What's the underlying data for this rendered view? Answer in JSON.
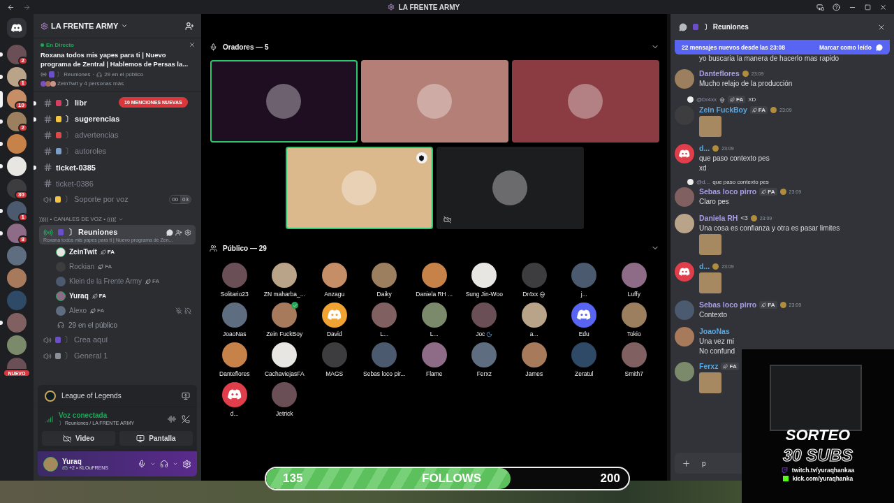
{
  "titlebar": {
    "title": "LA FRENTE ARMY"
  },
  "servers": [
    {
      "kind": "count",
      "badge": "2",
      "unread": true,
      "selected": false
    },
    {
      "kind": "count",
      "badge": "1",
      "unread": true,
      "selected": false
    },
    {
      "kind": "count",
      "badge": "10",
      "unread": false,
      "selected": true
    },
    {
      "kind": "count",
      "badge": "2",
      "unread": true,
      "selected": false
    },
    {
      "kind": "plain",
      "unread": true,
      "selected": false
    },
    {
      "kind": "plain",
      "unread": true,
      "selected": false
    },
    {
      "kind": "count",
      "badge": "30",
      "unread": false,
      "selected": false
    },
    {
      "kind": "count",
      "badge": "1",
      "unread": true,
      "selected": false
    },
    {
      "kind": "count",
      "badge": "8",
      "unread": true,
      "selected": false
    },
    {
      "kind": "plain",
      "unread": false,
      "selected": false
    },
    {
      "kind": "plain",
      "unread": false,
      "selected": false
    },
    {
      "kind": "plain",
      "unread": false,
      "selected": false
    },
    {
      "kind": "plain",
      "unread": true,
      "selected": false
    },
    {
      "kind": "plain",
      "unread": false,
      "selected": false
    },
    {
      "kind": "new",
      "badge": "NUEVO",
      "unread": false,
      "selected": false
    }
  ],
  "server_header": {
    "name": "LA FRENTE ARMY"
  },
  "live_card": {
    "status": "En Directo",
    "title": "Roxana todos mis yapes para ti | Nuevo programa de Zentral | Hablemos de Persas la...",
    "channel": "〕 Reuniones",
    "separator": "·",
    "audience": "29 en el público",
    "people": "ZeinTwit y 4 personas más"
  },
  "channels": [
    {
      "kind": "text",
      "name": "〕 libr",
      "unread": true,
      "mention": "10 MENCIONES NUEVAS"
    },
    {
      "kind": "text",
      "name": "〕 sugerencias",
      "unread": true
    },
    {
      "kind": "text",
      "name": "〕 advertencias",
      "unread": false
    },
    {
      "kind": "text",
      "name": "〕 autoroles",
      "unread": false
    },
    {
      "kind": "thread",
      "name": "ticket-0385",
      "unread": true
    },
    {
      "kind": "thread",
      "name": "ticket-0386",
      "unread": false
    },
    {
      "kind": "voice",
      "name": "〕 Soporte por voz",
      "unread": false,
      "counter": [
        "00",
        "03"
      ]
    }
  ],
  "voice_category": "))))) • CANALES DE VOZ • (((((",
  "stage_channel": {
    "name": "〕 Reuniones",
    "subtitle": "Roxana todos mis yapes para ti | Nuevo programa de Zen...",
    "selected": true
  },
  "participants": [
    {
      "name": "ZeinTwit",
      "tag": "FA",
      "active": true,
      "muted": false
    },
    {
      "name": "Rockian",
      "tag": "FA",
      "active": false,
      "muted": false
    },
    {
      "name": "Klein de la Frente Army",
      "tag": "FA",
      "active": false,
      "muted": false
    },
    {
      "name": "Yuraq",
      "tag": "FA",
      "active": true,
      "muted": false
    },
    {
      "name": "Alexo",
      "tag": "FA",
      "active": false,
      "muted": true
    }
  ],
  "audience_count": "29 en el público",
  "more_voice_channels": [
    {
      "name": "〕 Crea aquí"
    },
    {
      "name": "〕 General 1"
    }
  ],
  "activity": {
    "game": "League of Legends"
  },
  "voice": {
    "status": "Voz conectada",
    "location": "〕 Reuniones / LA FRENTE ARMY"
  },
  "media_buttons": [
    {
      "kind": "video",
      "label": "Video"
    },
    {
      "kind": "screen",
      "label": "Pantalla"
    }
  ],
  "user": {
    "name": "Yuraq",
    "extra": "+2 •",
    "custom": "KLOuFRENS"
  },
  "stage": {
    "speakers_header": "Oradores — 5",
    "audience_header": "Público — 29"
  },
  "speakers": [
    {
      "color": "#1f0d22",
      "speaking": true,
      "moderator": false,
      "muted": false
    },
    {
      "color": "#b47f76",
      "speaking": false,
      "moderator": false,
      "muted": false
    },
    {
      "color": "#8a3c42",
      "speaking": false,
      "moderator": false,
      "muted": false
    },
    {
      "color": "#dcb98c",
      "speaking": true,
      "moderator": true,
      "muted": false
    },
    {
      "color": "#1c1d1f",
      "speaking": false,
      "moderator": false,
      "muted": true
    }
  ],
  "audience": [
    {
      "name": "Solitario23",
      "kind": "photo"
    },
    {
      "name": "ZN maharba_...",
      "kind": "photo"
    },
    {
      "name": "Anzagu",
      "kind": "photo"
    },
    {
      "name": "Daiky",
      "kind": "photo"
    },
    {
      "name": "Daniela RH ...",
      "kind": "photo"
    },
    {
      "name": "Sung Jin-Woo",
      "kind": "photo"
    },
    {
      "name": "Dr4xx",
      "kind": "photo",
      "skull": true
    },
    {
      "name": "j...",
      "kind": "photo"
    },
    {
      "name": "Luffy",
      "kind": "photo"
    },
    {
      "name": "JoaoNas",
      "kind": "photo"
    },
    {
      "name": "Zein FuckBoy",
      "kind": "photo",
      "verified": true
    },
    {
      "name": "David",
      "kind": "discord",
      "color": "#f0a232"
    },
    {
      "name": "L...",
      "kind": "photo"
    },
    {
      "name": "L...",
      "kind": "photo"
    },
    {
      "name": "Joc",
      "kind": "photo",
      "sleep": true
    },
    {
      "name": "a...",
      "kind": "photo"
    },
    {
      "name": "Edu",
      "kind": "discord",
      "color": "#5865f2"
    },
    {
      "name": "Tokio",
      "kind": "photo"
    },
    {
      "name": "Danteflores",
      "kind": "photo"
    },
    {
      "name": "CachaviejasFA",
      "kind": "photo"
    },
    {
      "name": "MAGS",
      "kind": "photo"
    },
    {
      "name": "Sebas loco pir...",
      "kind": "photo"
    },
    {
      "name": "Flame",
      "kind": "photo"
    },
    {
      "name": "Ferxz",
      "kind": "photo"
    },
    {
      "name": "James",
      "kind": "photo"
    },
    {
      "name": "Zeratul",
      "kind": "photo"
    },
    {
      "name": "Smith7",
      "kind": "photo"
    },
    {
      "name": "d...",
      "kind": "discord",
      "color": "#e03e4a"
    },
    {
      "name": "Jetrick",
      "kind": "photo"
    }
  ],
  "chat": {
    "channel": "〕 Reuniones",
    "banner": "22 mensajes nuevos desde las 23:08",
    "mark_read": "Marcar como leído",
    "input_value": "p"
  },
  "messages": [
    {
      "kind": "cut",
      "lines": [
        "yo buscaria la manera de  hacerlo mas rapido"
      ]
    },
    {
      "kind": "message",
      "author": "Danteflores",
      "color": "#a99ee3",
      "discord_avatar": false,
      "time": "23:09",
      "lines": [
        "Mucho relajo de la producción"
      ]
    },
    {
      "kind": "message",
      "reply": {
        "author": "@Dr4xx",
        "skull": true,
        "tag": "FA",
        "text": "XD"
      },
      "author": "Zein FuckBoy",
      "color": "#5aa6dd",
      "discord_avatar": false,
      "tag": "FA",
      "time": "23:09",
      "sticker": true
    },
    {
      "kind": "message",
      "author": "d...",
      "color": "#5aa6dd",
      "discord_avatar": true,
      "time": "23:09",
      "lines": [
        "que paso contexto pes",
        "xd"
      ]
    },
    {
      "kind": "message",
      "reply": {
        "author": "@d...",
        "text": "que paso contexto pes"
      },
      "author": "Sebas loco pirro",
      "color": "#a99ee3",
      "discord_avatar": false,
      "tag": "FA",
      "time": "23:09",
      "lines": [
        "Claro pes"
      ]
    },
    {
      "kind": "message",
      "author": "Daniela RH",
      "color": "#a99ee3",
      "discord_avatar": false,
      "extra": "<3",
      "time": "23:09",
      "lines": [
        "Una cosa es confianza y otra es pasar limites"
      ],
      "sticker": true
    },
    {
      "kind": "message",
      "author": "d...",
      "color": "#5aa6dd",
      "discord_avatar": true,
      "time": "23:09",
      "sticker": true
    },
    {
      "kind": "message",
      "author": "Sebas loco pirro",
      "color": "#a99ee3",
      "discord_avatar": false,
      "tag": "FA",
      "time": "23:09",
      "lines": [
        "Contexto"
      ]
    },
    {
      "kind": "message",
      "author": "JoaoNas",
      "color": "#5aa6dd",
      "discord_avatar": false,
      "lines": [
        "Una vez mi",
        "No confund"
      ]
    },
    {
      "kind": "message",
      "author": "Ferxz",
      "color": "#5aa6dd",
      "discord_avatar": false,
      "tag": "FA",
      "sticker": true
    }
  ],
  "giveaway": {
    "title": "SORTEO",
    "subtitle": "30 SUBS",
    "links": [
      {
        "kind": "twitch",
        "text": "twitch.tv/yuraqhankaa"
      },
      {
        "kind": "kick",
        "text": "kick.com/yuraqhanka"
      }
    ]
  },
  "follows_bar": {
    "current": "135",
    "label": "FOLLOWS",
    "goal": "200",
    "level": 0.675
  }
}
